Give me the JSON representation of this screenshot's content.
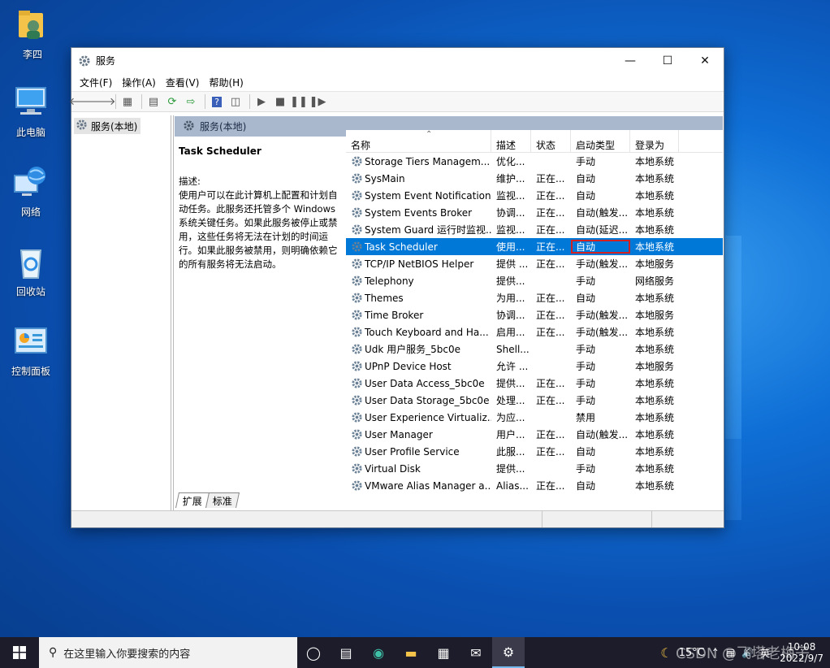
{
  "desktop": {
    "icons": [
      {
        "label": "李四",
        "icon": "user-folder-icon"
      },
      {
        "label": "此电脑",
        "icon": "computer-icon"
      },
      {
        "label": "网络",
        "icon": "network-icon"
      },
      {
        "label": "回收站",
        "icon": "recycle-bin-icon"
      },
      {
        "label": "控制面板",
        "icon": "control-panel-icon"
      }
    ]
  },
  "window": {
    "title": "服务",
    "menu": [
      "文件(F)",
      "操作(A)",
      "查看(V)",
      "帮助(H)"
    ],
    "tree_item": "服务(本地)",
    "pane_header": "服务(本地)",
    "description": {
      "service_name": "Task Scheduler",
      "label": "描述:",
      "text": "使用户可以在此计算机上配置和计划自动任务。此服务还托管多个 Windows 系统关键任务。如果此服务被停止或禁用，这些任务将无法在计划的时间运行。如果此服务被禁用，则明确依赖它的所有服务将无法启动。"
    },
    "columns": [
      "名称",
      "描述",
      "状态",
      "启动类型",
      "登录为"
    ],
    "rows": [
      {
        "name": "Storage Tiers Managem...",
        "desc": "优化...",
        "status": "",
        "start": "手动",
        "logon": "本地系统"
      },
      {
        "name": "SysMain",
        "desc": "维护...",
        "status": "正在...",
        "start": "自动",
        "logon": "本地系统"
      },
      {
        "name": "System Event Notification...",
        "desc": "监视...",
        "status": "正在...",
        "start": "自动",
        "logon": "本地系统"
      },
      {
        "name": "System Events Broker",
        "desc": "协调...",
        "status": "正在...",
        "start": "自动(触发...",
        "logon": "本地系统"
      },
      {
        "name": "System Guard 运行时监视...",
        "desc": "监视...",
        "status": "正在...",
        "start": "自动(延迟...",
        "logon": "本地系统"
      },
      {
        "name": "Task Scheduler",
        "desc": "使用...",
        "status": "正在...",
        "start": "自动",
        "logon": "本地系统"
      },
      {
        "name": "TCP/IP NetBIOS Helper",
        "desc": "提供 ...",
        "status": "正在...",
        "start": "手动(触发...",
        "logon": "本地服务"
      },
      {
        "name": "Telephony",
        "desc": "提供...",
        "status": "",
        "start": "手动",
        "logon": "网络服务"
      },
      {
        "name": "Themes",
        "desc": "为用...",
        "status": "正在...",
        "start": "自动",
        "logon": "本地系统"
      },
      {
        "name": "Time Broker",
        "desc": "协调...",
        "status": "正在...",
        "start": "手动(触发...",
        "logon": "本地服务"
      },
      {
        "name": "Touch Keyboard and Ha...",
        "desc": "启用...",
        "status": "正在...",
        "start": "手动(触发...",
        "logon": "本地系统"
      },
      {
        "name": "Udk 用户服务_5bc0e",
        "desc": "Shell...",
        "status": "",
        "start": "手动",
        "logon": "本地系统"
      },
      {
        "name": "UPnP Device Host",
        "desc": "允许 ...",
        "status": "",
        "start": "手动",
        "logon": "本地服务"
      },
      {
        "name": "User Data Access_5bc0e",
        "desc": "提供...",
        "status": "正在...",
        "start": "手动",
        "logon": "本地系统"
      },
      {
        "name": "User Data Storage_5bc0e",
        "desc": "处理...",
        "status": "正在...",
        "start": "手动",
        "logon": "本地系统"
      },
      {
        "name": "User Experience Virtualiz...",
        "desc": "为应...",
        "status": "",
        "start": "禁用",
        "logon": "本地系统"
      },
      {
        "name": "User Manager",
        "desc": "用户...",
        "status": "正在...",
        "start": "自动(触发...",
        "logon": "本地系统"
      },
      {
        "name": "User Profile Service",
        "desc": "此服...",
        "status": "正在...",
        "start": "自动",
        "logon": "本地系统"
      },
      {
        "name": "Virtual Disk",
        "desc": "提供...",
        "status": "",
        "start": "手动",
        "logon": "本地系统"
      },
      {
        "name": "VMware Alias Manager a...",
        "desc": "Alias...",
        "status": "正在...",
        "start": "自动",
        "logon": "本地系统"
      }
    ],
    "tabs": [
      "扩展",
      "标准"
    ]
  },
  "taskbar": {
    "search_placeholder": "在这里输入你要搜索的内容",
    "weather": "15°C",
    "ime": "英",
    "time": "10:08",
    "date": "2022/9/7"
  },
  "watermark": "CSDN @飞塔老梅子"
}
